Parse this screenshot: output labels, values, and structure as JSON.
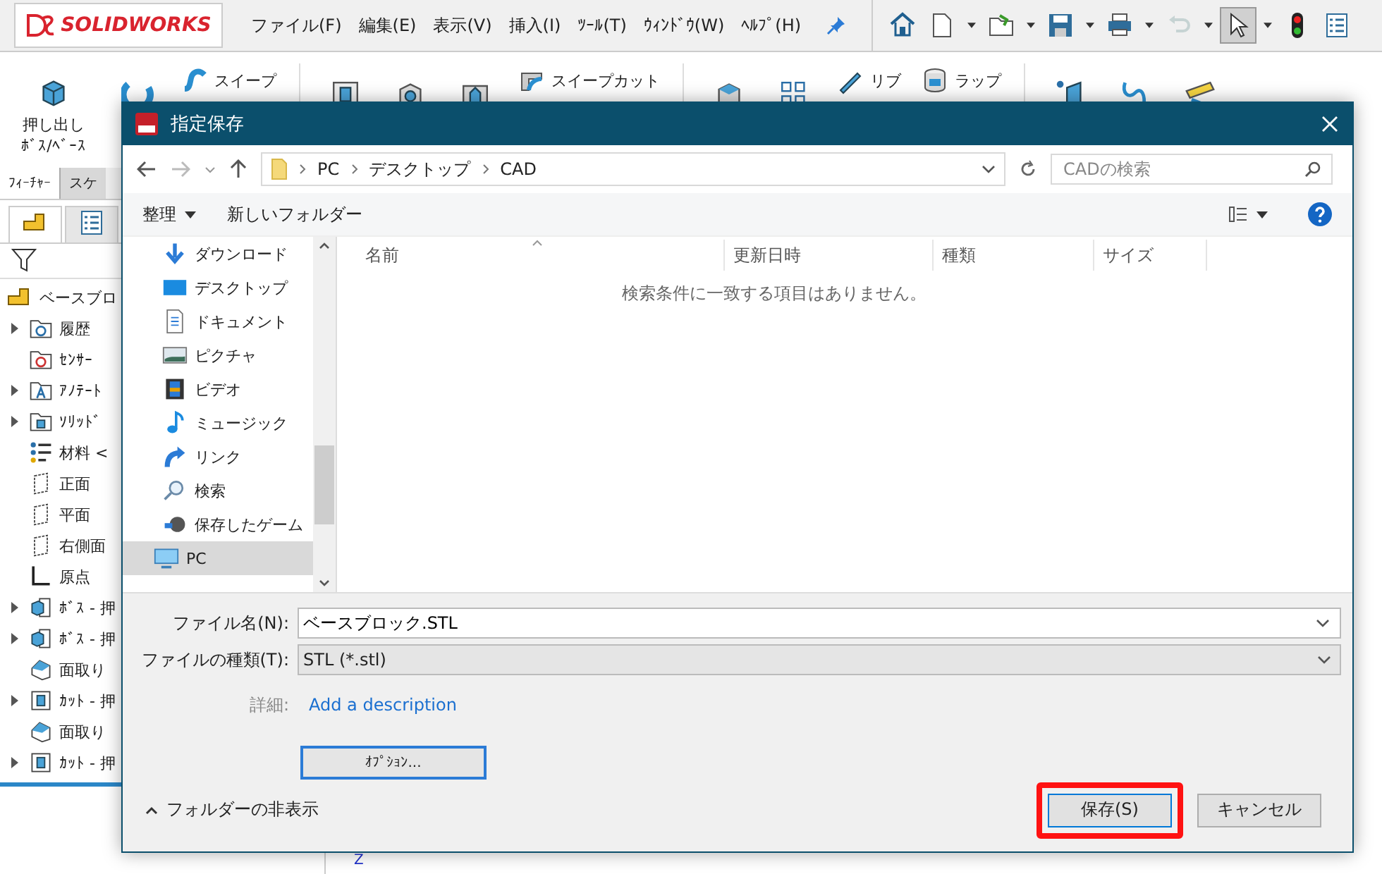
{
  "app": {
    "logo": "SOLIDWORKS",
    "menus": [
      "ファイル(F)",
      "編集(E)",
      "表示(V)",
      "挿入(I)",
      "ﾂｰﾙ(T)",
      "ｳｨﾝﾄﾞｳ(W)",
      "ﾍﾙﾌﾟ(H)"
    ],
    "toolbar": [
      {
        "disabled": false,
        "selected": false,
        "dropdown": false
      },
      {
        "disabled": false,
        "selected": false,
        "dropdown": true
      },
      {
        "disabled": false,
        "selected": false,
        "dropdown": true
      },
      {
        "disabled": false,
        "selected": false,
        "dropdown": true
      },
      {
        "disabled": false,
        "selected": false,
        "dropdown": true
      },
      {
        "disabled": true,
        "selected": false,
        "dropdown": true
      },
      {
        "disabled": false,
        "selected": true,
        "dropdown": true
      },
      {
        "disabled": false,
        "selected": false,
        "dropdown": false
      },
      {
        "disabled": false,
        "selected": false,
        "dropdown": false
      }
    ],
    "ribbon": [
      {
        "kind": "big",
        "lines": [
          "押し出し",
          "ﾎﾞｽ/ﾍﾞｰｽ"
        ]
      },
      {
        "kind": "icon"
      },
      {
        "kind": "small",
        "label": "スイープ"
      },
      {
        "kind": "sep"
      },
      {
        "kind": "icon"
      },
      {
        "kind": "icon"
      },
      {
        "kind": "icon"
      },
      {
        "kind": "small",
        "label": "スイープカット"
      },
      {
        "kind": "sep"
      },
      {
        "kind": "icon"
      },
      {
        "kind": "icon"
      },
      {
        "kind": "small",
        "label": "リブ"
      },
      {
        "kind": "small",
        "label": "ラップ"
      },
      {
        "kind": "sep"
      },
      {
        "kind": "icon"
      },
      {
        "kind": "icon"
      },
      {
        "kind": "icon"
      }
    ],
    "tabs": [
      {
        "label": "ﾌｨｰﾁｬｰ",
        "selected": true
      },
      {
        "label": "スケ",
        "selected": false
      }
    ],
    "tree": {
      "root": "ベースブロ",
      "items": [
        {
          "label": "履歴",
          "toggle": true
        },
        {
          "label": "ｾﾝｻｰ",
          "toggle": false
        },
        {
          "label": "ｱﾉﾃｰﾄ",
          "toggle": true
        },
        {
          "label": "ｿﾘｯﾄﾞ",
          "toggle": true
        },
        {
          "label": "材料 <",
          "toggle": false
        },
        {
          "label": "正面",
          "toggle": false
        },
        {
          "label": "平面",
          "toggle": false
        },
        {
          "label": "右側面",
          "toggle": false
        },
        {
          "label": "原点",
          "toggle": false
        },
        {
          "label": "ﾎﾞｽ - 押",
          "toggle": true
        },
        {
          "label": "ﾎﾞｽ - 押",
          "toggle": true
        },
        {
          "label": "面取り",
          "toggle": false
        },
        {
          "label": "ｶｯﾄ - 押",
          "toggle": true
        },
        {
          "label": "面取り",
          "toggle": false
        },
        {
          "label": "ｶｯﾄ - 押",
          "toggle": true
        }
      ]
    },
    "axis_label": "Z"
  },
  "dialog": {
    "title": "指定保存",
    "path": [
      "PC",
      "デスクトップ",
      "CAD"
    ],
    "search": {
      "placeholder": "CADの検索"
    },
    "commands": [
      {
        "label": "整理",
        "dropdown": true
      },
      {
        "label": "新しいフォルダー",
        "dropdown": false
      }
    ],
    "nav": [
      {
        "label": "ダウンロード",
        "selected": false
      },
      {
        "label": "デスクトップ",
        "selected": false
      },
      {
        "label": "ドキュメント",
        "selected": false
      },
      {
        "label": "ピクチャ",
        "selected": false
      },
      {
        "label": "ビデオ",
        "selected": false
      },
      {
        "label": "ミュージック",
        "selected": false
      },
      {
        "label": "リンク",
        "selected": false
      },
      {
        "label": "検索",
        "selected": false
      },
      {
        "label": "保存したゲーム",
        "selected": false
      },
      {
        "label": "PC",
        "selected": true
      }
    ],
    "columns": [
      "名前",
      "更新日時",
      "種類",
      "サイズ"
    ],
    "empty_message": "検索条件に一致する項目はありません。",
    "fields": [
      {
        "label": "ファイル名(N):",
        "value": "ベースブロック.STL",
        "kind": "combo"
      },
      {
        "label": "ファイルの種類(T):",
        "value": "STL (*.stl)",
        "kind": "select"
      }
    ],
    "details": {
      "label": "詳細:",
      "link": "Add a description"
    },
    "options_button": "ｵﾌﾟｼｮﾝ...",
    "hide_folders": "フォルダーの非表示",
    "buttons": [
      {
        "label": "保存(S)",
        "highlighted": true
      },
      {
        "label": "キャンセル",
        "highlighted": false
      }
    ]
  }
}
